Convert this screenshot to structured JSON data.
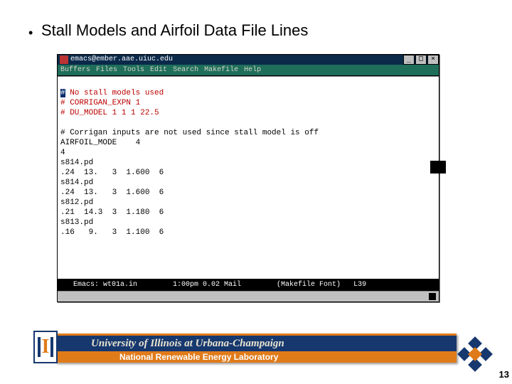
{
  "heading": "Stall Models and Airfoil Data File Lines",
  "window": {
    "title": "emacs@ember.aae.uiuc.edu",
    "controls": {
      "min": "_",
      "max": "□",
      "close": "×"
    }
  },
  "menu": {
    "buffers": "Buffers",
    "files": "Files",
    "tools": "Tools",
    "edit": "Edit",
    "search": "Search",
    "makefile": "Makefile",
    "help": "Help"
  },
  "lines": {
    "l0a": "#",
    "l0b": " No stall models used",
    "l1": "# CORRIGAN_EXPN 1",
    "l2": "# DU_MODEL 1 1 1 22.5",
    "l3": "",
    "l4": "# Corrigan inputs are not used since stall model is off",
    "l5": "AIRFOIL_MODE    4",
    "l6": "4",
    "l7": "s814.pd",
    "l8": ".24  13.   3  1.600  6",
    "l9": "s814.pd",
    "l10": ".24  13.   3  1.600  6",
    "l11": "s812.pd",
    "l12": ".21  14.3  3  1.180  6",
    "l13": "s813.pd",
    "l14": ".16   9.   3  1.100  6"
  },
  "status": {
    "left": "   Emacs: wt01a.in",
    "mid": "1:00pm 0.02 Mail",
    "right": "(Makefile Font)   L39"
  },
  "footer": {
    "university": "University of Illinois at Urbana-Champaign",
    "lab": "National Renewable Energy Laboratory"
  },
  "page_number": "13",
  "logo_letter": "I"
}
